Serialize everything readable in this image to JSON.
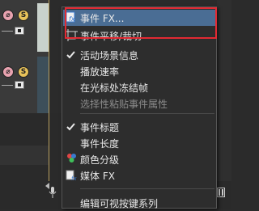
{
  "timeline": {
    "track1": {
      "mute_label": "⌀",
      "solo_label": "S"
    },
    "track2": {
      "mute_label": "⌀",
      "solo_label": "S"
    }
  },
  "context_menu": {
    "items": [
      {
        "label": "事件 FX...",
        "type": "icon",
        "icon": "fx-icon",
        "state": "hover"
      },
      {
        "label": "事件平移/裁切",
        "type": "icon",
        "icon": "pan-crop-icon"
      },
      {
        "label": "活动场景信息",
        "type": "check",
        "checked": true
      },
      {
        "label": "播放速率",
        "type": "plain"
      },
      {
        "label": "在光标处冻结帧",
        "type": "plain"
      },
      {
        "label": "选择性粘贴事件属性",
        "type": "plain",
        "disabled": true
      },
      {
        "label": "事件标题",
        "type": "check",
        "checked": true
      },
      {
        "label": "事件长度",
        "type": "plain"
      },
      {
        "label": "颜色分级",
        "type": "icon",
        "icon": "color-grading-icon"
      },
      {
        "label": "媒体 FX",
        "type": "icon",
        "icon": "media-fx-icon"
      },
      {
        "label": "编辑可视按键系列",
        "type": "plain"
      }
    ]
  },
  "colors": {
    "menu_bg": "#2d2d2d",
    "hover_bg": "#4a6d94",
    "highlight_border": "#e22a33",
    "text": "#e8e8e8",
    "disabled_text": "#8a8a8a"
  }
}
